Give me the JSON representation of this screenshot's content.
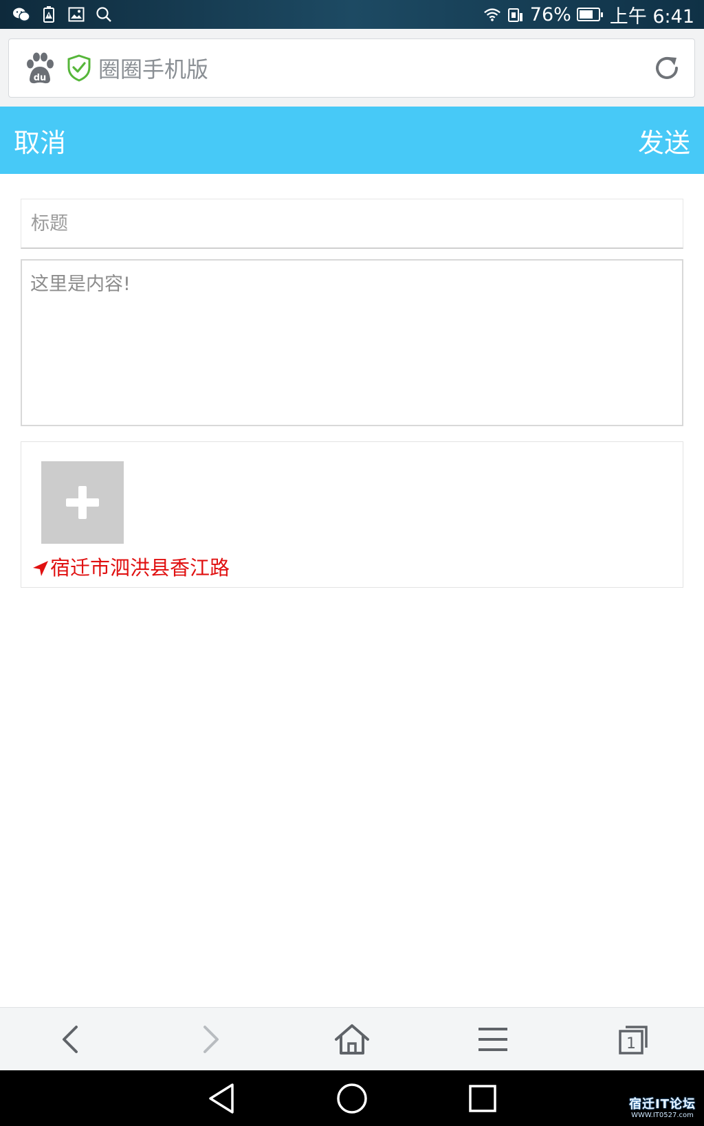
{
  "status_bar": {
    "left_icons": [
      "wechat-icon",
      "battery-alert-icon",
      "image-icon",
      "search-icon"
    ],
    "battery_percent": "76%",
    "battery_level": 0.76,
    "time": "上午 6:41"
  },
  "address_bar": {
    "site_title": "圈圈手机版",
    "brand_color": "#47c9f7"
  },
  "header": {
    "cancel_label": "取消",
    "send_label": "发送"
  },
  "form": {
    "title_placeholder": "标题",
    "content_placeholder": "这里是内容!",
    "location_text": "宿迁市泗洪县香江路",
    "location_color": "#e01010"
  },
  "browser_toolbar": {
    "tab_count": "1"
  },
  "watermark": {
    "title": "宿迁IT论坛",
    "url": "WWW.IT0527.com"
  }
}
